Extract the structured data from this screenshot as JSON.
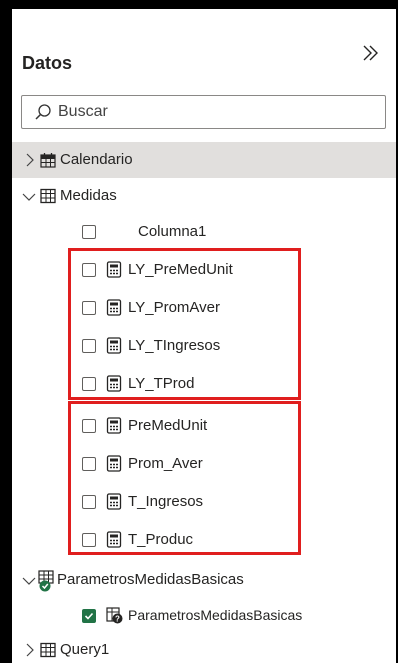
{
  "pane": {
    "title": "Datos"
  },
  "search": {
    "placeholder": "Buscar"
  },
  "tables": {
    "calendario": "Calendario",
    "medidas": "Medidas",
    "parametros_table": "ParametrosMedidasBasicas",
    "query1": "Query1"
  },
  "fields": {
    "columna1": "Columna1",
    "ly_premedunit": "LY_PreMedUnit",
    "ly_promaver": "LY_PromAver",
    "ly_tingresos": "LY_TIngresos",
    "ly_tprod": "LY_TProd",
    "premedunit": "PreMedUnit",
    "prom_aver": "Prom_Aver",
    "t_ingresos": "T_Ingresos",
    "t_produc": "T_Produc",
    "parametros_field": "ParametrosMedidasBasicas"
  },
  "colors": {
    "highlight_box": "#e01e1e",
    "checkbox_checked": "#217346",
    "selected_row": "#e1dfdd"
  },
  "icons": [
    "collapse-pane-icon",
    "search-icon",
    "chevron-right-icon",
    "chevron-down-icon",
    "calendar-table-icon",
    "table-icon",
    "calculator-measure-icon",
    "parameter-table-icon",
    "parameter-field-icon",
    "checkmark-icon"
  ]
}
